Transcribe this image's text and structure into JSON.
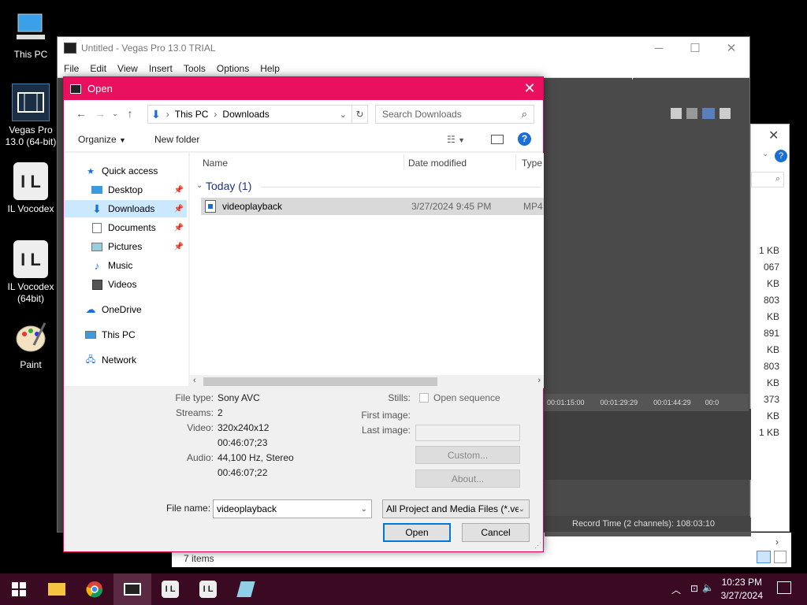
{
  "desktop": {
    "icons": [
      {
        "label": "This PC"
      },
      {
        "label": "Vegas Pro 13.0 (64-bit)"
      },
      {
        "label": "IL Vocodex"
      },
      {
        "label": "IL Vocodex (64bit)"
      },
      {
        "label": "Paint"
      }
    ]
  },
  "vegas": {
    "title": "Untitled - Vegas Pro 13.0 TRIAL",
    "menu": [
      "File",
      "Edit",
      "View",
      "Insert",
      "Tools",
      "Options",
      "Help"
    ],
    "timecodes": [
      "00:01:15:00",
      "00:01:29:29",
      "00:01:44:29",
      "00:0"
    ],
    "status": "Record Time (2 channels): 108:03:10"
  },
  "bg_explorer": {
    "sizes": [
      "1 KB",
      "067 KB",
      "803 KB",
      "891 KB",
      "803 KB",
      "373 KB",
      "1 KB"
    ],
    "items_count": "7 items"
  },
  "dialog": {
    "title": "Open",
    "address": {
      "root": "This PC",
      "folder": "Downloads"
    },
    "search_placeholder": "Search Downloads",
    "toolbar": {
      "organize": "Organize",
      "new_folder": "New folder"
    },
    "nav": {
      "quick_access": "Quick access",
      "items": [
        "Desktop",
        "Downloads",
        "Documents",
        "Pictures",
        "Music",
        "Videos"
      ],
      "onedrive": "OneDrive",
      "this_pc": "This PC",
      "network": "Network"
    },
    "columns": {
      "name": "Name",
      "date": "Date modified",
      "type": "Type"
    },
    "group": "Today (1)",
    "file": {
      "name": "videoplayback",
      "date": "3/27/2024 9:45 PM",
      "type": "MP4"
    },
    "info": {
      "file_type_label": "File type:",
      "file_type": "Sony AVC",
      "streams_label": "Streams:",
      "streams": "2",
      "video_label": "Video:",
      "video": "320x240x12",
      "video_dur": "00:46:07;23",
      "audio_label": "Audio:",
      "audio": "44,100 Hz, Stereo",
      "audio_dur": "00:46:07;22",
      "stills_label": "Stills:",
      "open_sequence": "Open sequence",
      "first_image_label": "First image:",
      "last_image_label": "Last image:",
      "custom": "Custom...",
      "about": "About..."
    },
    "file_name_label": "File name:",
    "file_name": "videoplayback",
    "file_types": "All Project and Media Files (*.ve",
    "open_button": "Open",
    "cancel_button": "Cancel"
  },
  "taskbar": {
    "time": "10:23 PM",
    "date": "3/27/2024"
  }
}
